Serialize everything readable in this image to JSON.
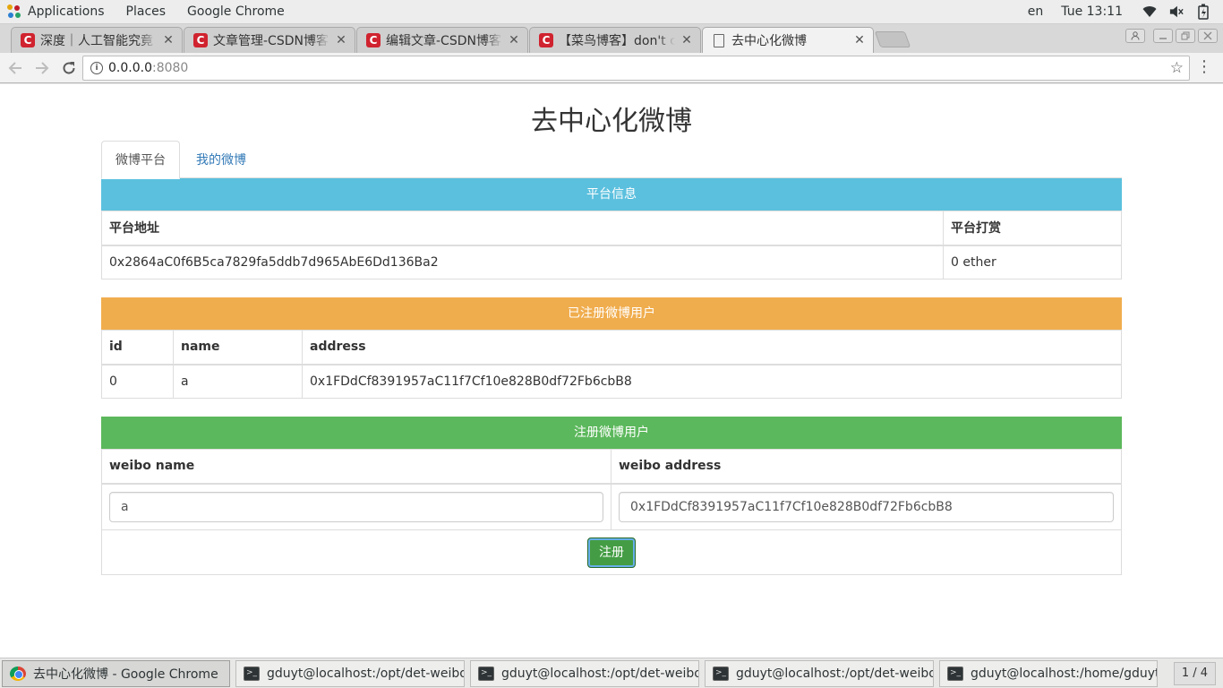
{
  "topbar": {
    "applications": "Applications",
    "places": "Places",
    "app_name": "Google Chrome",
    "lang": "en",
    "clock": "Tue 13:11",
    "icons": [
      "wifi-icon",
      "volume-muted-icon",
      "battery-icon"
    ]
  },
  "tabs": [
    {
      "title": "深度｜人工智能究竟",
      "favicon": "csdn-favicon-icon",
      "active": false
    },
    {
      "title": "文章管理-CSDN博客",
      "favicon": "csdn-favicon-icon",
      "active": false
    },
    {
      "title": "编辑文章-CSDN博客",
      "favicon": "csdn-favicon-icon",
      "active": false
    },
    {
      "title": "【菜鸟博客】don't c",
      "favicon": "csdn-favicon-icon",
      "active": false
    },
    {
      "title": "去中心化微博",
      "favicon": "document-icon",
      "active": true
    }
  ],
  "favicon_letter": "C",
  "omnibox": {
    "host": "0.0.0.0",
    "port": ":8080"
  },
  "page": {
    "title": "去中心化微博",
    "nav_tabs": [
      "微博平台",
      "我的微博"
    ],
    "platform": {
      "heading": "平台信息",
      "headers": [
        "平台地址",
        "平台打赏"
      ],
      "row": [
        "0x2864aC0f6B5ca7829fa5ddb7d965AbE6Dd136Ba2",
        "0 ether"
      ]
    },
    "users": {
      "heading": "已注册微博用户",
      "headers": [
        "id",
        "name",
        "address"
      ],
      "rows": [
        [
          "0",
          "a",
          "0x1FDdCf8391957aC11f7Cf10e828B0df72Fb6cbB8"
        ]
      ]
    },
    "register": {
      "heading": "注册微博用户",
      "headers": [
        "weibo name",
        "weibo address"
      ],
      "name_value": "a",
      "address_value": "0x1FDdCf8391957aC11f7Cf10e828B0df72Fb6cbB8",
      "button": "注册"
    }
  },
  "colors": {
    "info": "#5bc0de",
    "warning": "#f0ad4e",
    "success": "#5cb85c",
    "link": "#337ab7"
  },
  "taskbar": {
    "items": [
      {
        "label": "去中心化微博 - Google Chrome",
        "icon": "chrome-icon",
        "active": true
      },
      {
        "label": "gduyt@localhost:/opt/det-weibo/app",
        "icon": "terminal-icon",
        "active": false
      },
      {
        "label": "gduyt@localhost:/opt/det-weibo/app",
        "icon": "terminal-icon",
        "active": false
      },
      {
        "label": "gduyt@localhost:/opt/det-weibo/app",
        "icon": "terminal-icon",
        "active": false
      },
      {
        "label": "gduyt@localhost:/home/gduyt",
        "icon": "terminal-icon",
        "active": false
      }
    ],
    "pager": "1 / 4"
  }
}
